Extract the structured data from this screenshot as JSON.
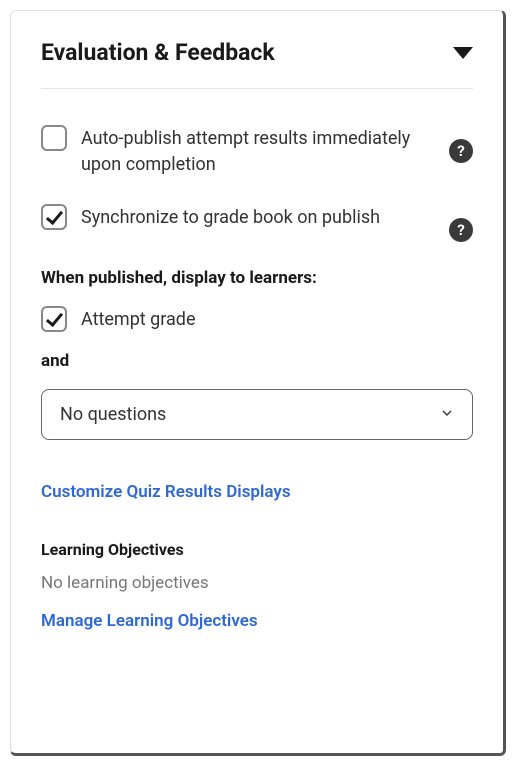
{
  "header": {
    "title": "Evaluation & Feedback"
  },
  "options": {
    "auto_publish": {
      "label": "Auto-publish attempt results immediately upon completion",
      "checked": false
    },
    "sync_gradebook": {
      "label": "Synchronize to grade book on publish",
      "checked": true
    }
  },
  "display_section": {
    "heading": "When published, display to learners:",
    "attempt_grade": {
      "label": "Attempt grade",
      "checked": true
    },
    "and_label": "and",
    "select_value": "No questions"
  },
  "links": {
    "customize": "Customize Quiz Results Displays",
    "manage_objectives": "Manage Learning Objectives"
  },
  "learning_objectives": {
    "heading": "Learning Objectives",
    "empty_text": "No learning objectives"
  },
  "icons": {
    "help": "?"
  }
}
